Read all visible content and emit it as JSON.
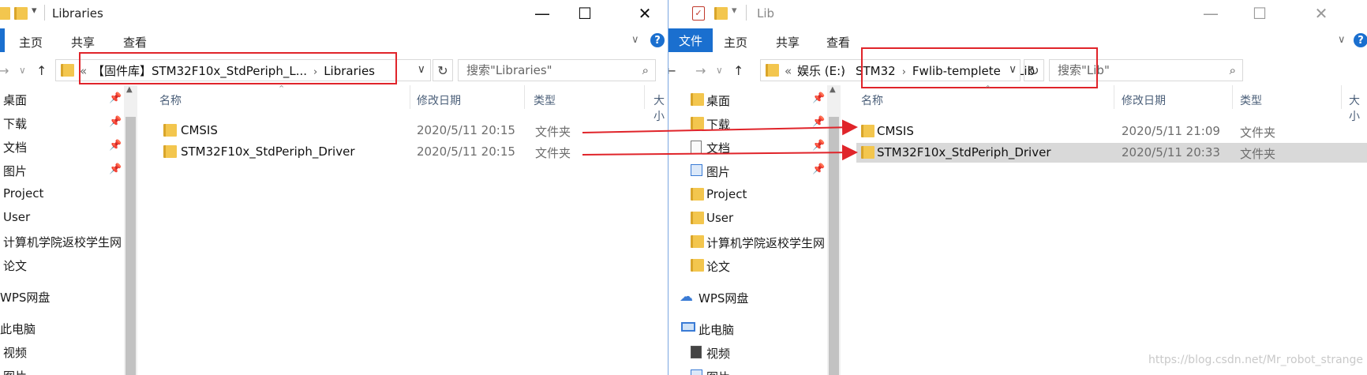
{
  "left": {
    "title": "Libraries",
    "ribbon_tabs": [
      "主页",
      "共享",
      "查看"
    ],
    "address": {
      "prefix": "«",
      "segments": [
        "【固件库】STM32F10x_StdPeriph_L...",
        "Libraries"
      ]
    },
    "search_placeholder": "搜索\"Libraries\"",
    "nav_items": [
      {
        "label": "桌面",
        "pinned": true
      },
      {
        "label": "下载",
        "pinned": true
      },
      {
        "label": "文档",
        "pinned": true
      },
      {
        "label": "图片",
        "pinned": true
      },
      {
        "label": "Project",
        "pinned": false
      },
      {
        "label": "User",
        "pinned": false
      },
      {
        "label": "计算机学院返校学生网",
        "pinned": false
      },
      {
        "label": "论文",
        "pinned": false
      },
      {
        "label": "WPS网盘",
        "pinned": false
      },
      {
        "label": "此电脑",
        "pinned": false
      },
      {
        "label": "视频",
        "pinned": false
      },
      {
        "label": "图片",
        "pinned": false
      }
    ],
    "columns": [
      "名称",
      "修改日期",
      "类型",
      "大小"
    ],
    "files": [
      {
        "name": "CMSIS",
        "date": "2020/5/11 20:15",
        "type": "文件夹"
      },
      {
        "name": "STM32F10x_StdPeriph_Driver",
        "date": "2020/5/11 20:15",
        "type": "文件夹"
      }
    ]
  },
  "right": {
    "title": "Lib",
    "file_tab": "文件",
    "ribbon_tabs": [
      "主页",
      "共享",
      "查看"
    ],
    "address": {
      "prefix": "«",
      "drive": "娱乐 (E:)",
      "segments": [
        "STM32",
        "Fwlib-templete",
        "Lib"
      ]
    },
    "search_placeholder": "搜索\"Lib\"",
    "nav_items": [
      {
        "label": "桌面",
        "pinned": true
      },
      {
        "label": "下载",
        "pinned": true
      },
      {
        "label": "文档",
        "pinned": true
      },
      {
        "label": "图片",
        "pinned": true
      },
      {
        "label": "Project",
        "pinned": false
      },
      {
        "label": "User",
        "pinned": false
      },
      {
        "label": "计算机学院返校学生网",
        "pinned": false
      },
      {
        "label": "论文",
        "pinned": false
      },
      {
        "label": "WPS网盘",
        "pinned": false
      },
      {
        "label": "此电脑",
        "pinned": false
      },
      {
        "label": "视频",
        "pinned": false
      },
      {
        "label": "图片",
        "pinned": false
      }
    ],
    "columns": [
      "名称",
      "修改日期",
      "类型",
      "大小"
    ],
    "files": [
      {
        "name": "CMSIS",
        "date": "2020/5/11 21:09",
        "type": "文件夹",
        "selected": false
      },
      {
        "name": "STM32F10x_StdPeriph_Driver",
        "date": "2020/5/11 20:33",
        "type": "文件夹",
        "selected": true
      }
    ]
  },
  "glyphs": {
    "minimize": "—",
    "maximize": "☐",
    "close": "✕",
    "back": "←",
    "forward": "→",
    "up": "↑",
    "chevron": "›",
    "dropdown": "∨",
    "refresh": "↻",
    "search": "⌕",
    "pin": "📌",
    "help": "?"
  },
  "annotation_color": "#e0242a",
  "watermark": "https://blog.csdn.net/Mr_robot_strange"
}
